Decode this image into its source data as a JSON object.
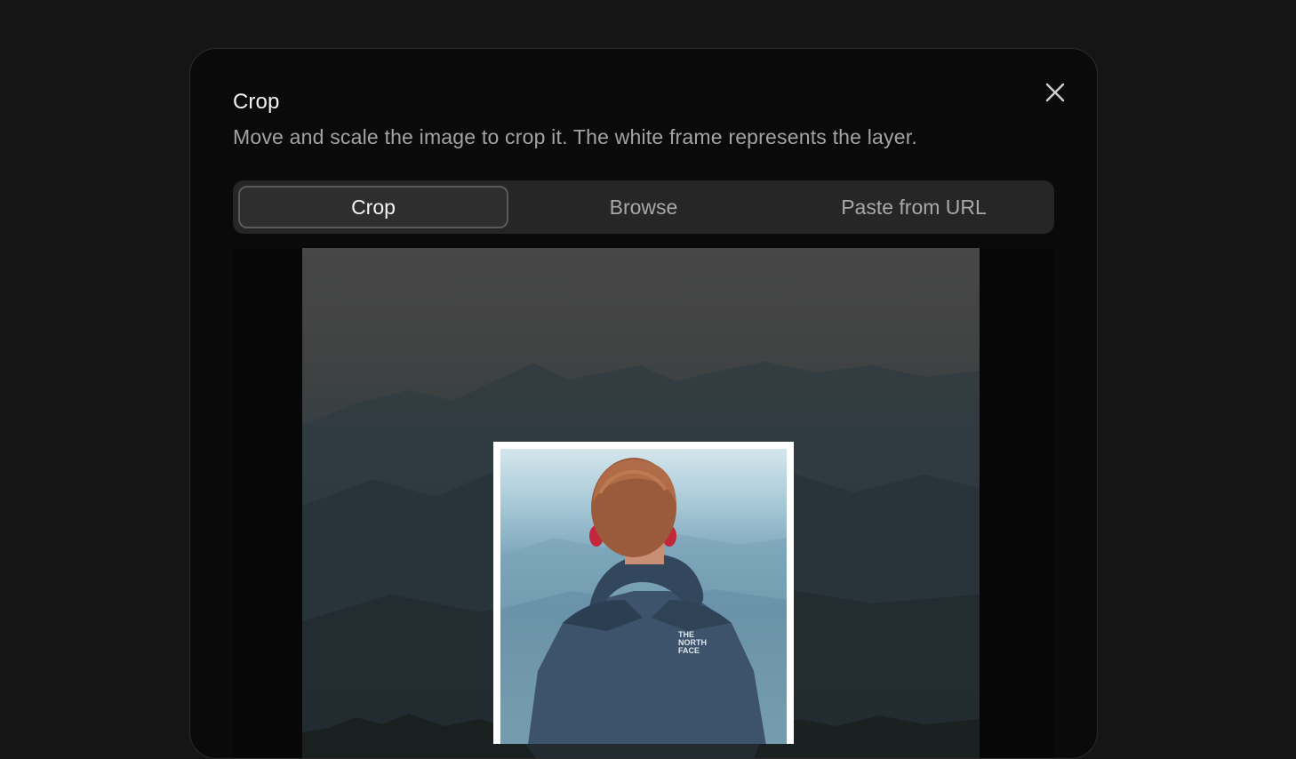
{
  "dialog": {
    "title": "Crop",
    "description": "Move and scale the image to crop it. The white frame represents the layer.",
    "close_icon": "close-icon"
  },
  "tabs": [
    {
      "label": "Crop",
      "active": true
    },
    {
      "label": "Browse",
      "active": false
    },
    {
      "label": "Paste from URL",
      "active": false
    }
  ],
  "colors": {
    "background": "#151515",
    "dialog": "#0a0a0a",
    "tab_bar": "#262626",
    "frame": "#ffffff"
  }
}
